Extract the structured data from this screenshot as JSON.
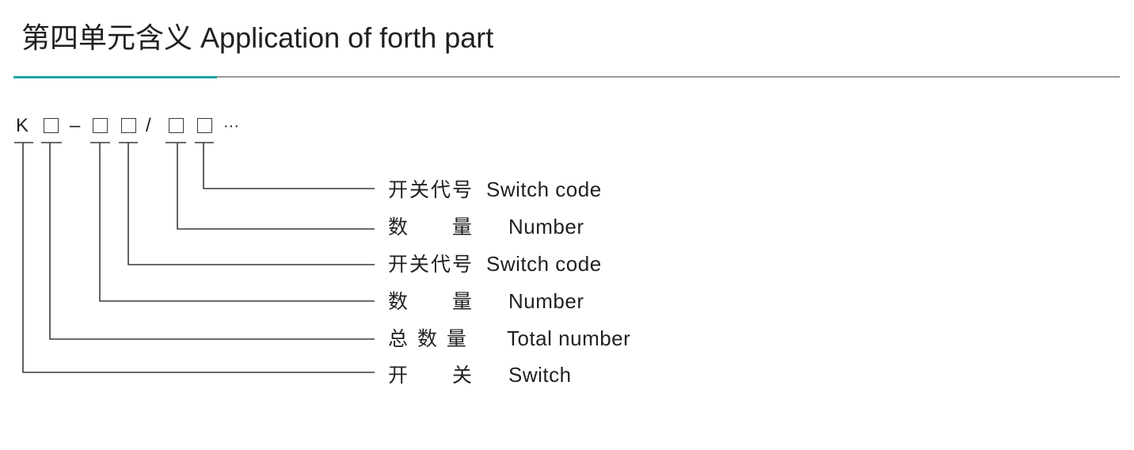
{
  "header": {
    "title_cn": "第四单元含义",
    "title_en": "Application of forth part",
    "accent_color": "#1fa3a5",
    "rule_color": "#9a9a9a"
  },
  "code": {
    "prefix": "K",
    "dash": "–",
    "slash": "/",
    "ellipsis": "···",
    "placeholder_icon": "empty-square-icon"
  },
  "legend": [
    {
      "cn": "开关代号",
      "en": "Switch code"
    },
    {
      "cn": "数　　量",
      "en": "Number"
    },
    {
      "cn": "开关代号",
      "en": "Switch code"
    },
    {
      "cn": "数　　量",
      "en": "Number"
    },
    {
      "cn": "总 数 量",
      "en": "Total number"
    },
    {
      "cn": "开　　关",
      "en": "Switch"
    }
  ]
}
